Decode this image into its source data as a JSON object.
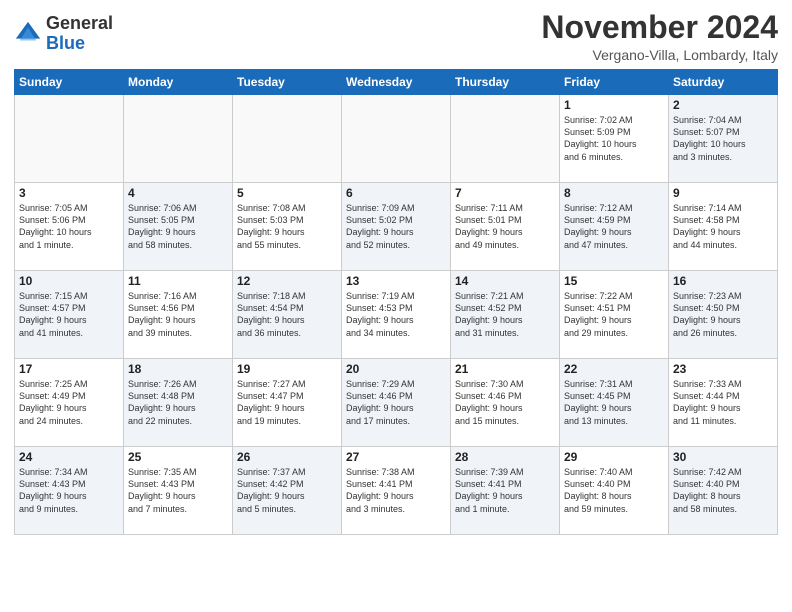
{
  "logo": {
    "line1": "General",
    "line2": "Blue"
  },
  "title": "November 2024",
  "location": "Vergano-Villa, Lombardy, Italy",
  "days_of_week": [
    "Sunday",
    "Monday",
    "Tuesday",
    "Wednesday",
    "Thursday",
    "Friday",
    "Saturday"
  ],
  "weeks": [
    [
      {
        "day": "",
        "info": "",
        "shaded": false,
        "empty": true
      },
      {
        "day": "",
        "info": "",
        "shaded": false,
        "empty": true
      },
      {
        "day": "",
        "info": "",
        "shaded": false,
        "empty": true
      },
      {
        "day": "",
        "info": "",
        "shaded": false,
        "empty": true
      },
      {
        "day": "",
        "info": "",
        "shaded": false,
        "empty": true
      },
      {
        "day": "1",
        "info": "Sunrise: 7:02 AM\nSunset: 5:09 PM\nDaylight: 10 hours\nand 6 minutes.",
        "shaded": false,
        "empty": false
      },
      {
        "day": "2",
        "info": "Sunrise: 7:04 AM\nSunset: 5:07 PM\nDaylight: 10 hours\nand 3 minutes.",
        "shaded": true,
        "empty": false
      }
    ],
    [
      {
        "day": "3",
        "info": "Sunrise: 7:05 AM\nSunset: 5:06 PM\nDaylight: 10 hours\nand 1 minute.",
        "shaded": false,
        "empty": false
      },
      {
        "day": "4",
        "info": "Sunrise: 7:06 AM\nSunset: 5:05 PM\nDaylight: 9 hours\nand 58 minutes.",
        "shaded": true,
        "empty": false
      },
      {
        "day": "5",
        "info": "Sunrise: 7:08 AM\nSunset: 5:03 PM\nDaylight: 9 hours\nand 55 minutes.",
        "shaded": false,
        "empty": false
      },
      {
        "day": "6",
        "info": "Sunrise: 7:09 AM\nSunset: 5:02 PM\nDaylight: 9 hours\nand 52 minutes.",
        "shaded": true,
        "empty": false
      },
      {
        "day": "7",
        "info": "Sunrise: 7:11 AM\nSunset: 5:01 PM\nDaylight: 9 hours\nand 49 minutes.",
        "shaded": false,
        "empty": false
      },
      {
        "day": "8",
        "info": "Sunrise: 7:12 AM\nSunset: 4:59 PM\nDaylight: 9 hours\nand 47 minutes.",
        "shaded": true,
        "empty": false
      },
      {
        "day": "9",
        "info": "Sunrise: 7:14 AM\nSunset: 4:58 PM\nDaylight: 9 hours\nand 44 minutes.",
        "shaded": false,
        "empty": false
      }
    ],
    [
      {
        "day": "10",
        "info": "Sunrise: 7:15 AM\nSunset: 4:57 PM\nDaylight: 9 hours\nand 41 minutes.",
        "shaded": true,
        "empty": false
      },
      {
        "day": "11",
        "info": "Sunrise: 7:16 AM\nSunset: 4:56 PM\nDaylight: 9 hours\nand 39 minutes.",
        "shaded": false,
        "empty": false
      },
      {
        "day": "12",
        "info": "Sunrise: 7:18 AM\nSunset: 4:54 PM\nDaylight: 9 hours\nand 36 minutes.",
        "shaded": true,
        "empty": false
      },
      {
        "day": "13",
        "info": "Sunrise: 7:19 AM\nSunset: 4:53 PM\nDaylight: 9 hours\nand 34 minutes.",
        "shaded": false,
        "empty": false
      },
      {
        "day": "14",
        "info": "Sunrise: 7:21 AM\nSunset: 4:52 PM\nDaylight: 9 hours\nand 31 minutes.",
        "shaded": true,
        "empty": false
      },
      {
        "day": "15",
        "info": "Sunrise: 7:22 AM\nSunset: 4:51 PM\nDaylight: 9 hours\nand 29 minutes.",
        "shaded": false,
        "empty": false
      },
      {
        "day": "16",
        "info": "Sunrise: 7:23 AM\nSunset: 4:50 PM\nDaylight: 9 hours\nand 26 minutes.",
        "shaded": true,
        "empty": false
      }
    ],
    [
      {
        "day": "17",
        "info": "Sunrise: 7:25 AM\nSunset: 4:49 PM\nDaylight: 9 hours\nand 24 minutes.",
        "shaded": false,
        "empty": false
      },
      {
        "day": "18",
        "info": "Sunrise: 7:26 AM\nSunset: 4:48 PM\nDaylight: 9 hours\nand 22 minutes.",
        "shaded": true,
        "empty": false
      },
      {
        "day": "19",
        "info": "Sunrise: 7:27 AM\nSunset: 4:47 PM\nDaylight: 9 hours\nand 19 minutes.",
        "shaded": false,
        "empty": false
      },
      {
        "day": "20",
        "info": "Sunrise: 7:29 AM\nSunset: 4:46 PM\nDaylight: 9 hours\nand 17 minutes.",
        "shaded": true,
        "empty": false
      },
      {
        "day": "21",
        "info": "Sunrise: 7:30 AM\nSunset: 4:46 PM\nDaylight: 9 hours\nand 15 minutes.",
        "shaded": false,
        "empty": false
      },
      {
        "day": "22",
        "info": "Sunrise: 7:31 AM\nSunset: 4:45 PM\nDaylight: 9 hours\nand 13 minutes.",
        "shaded": true,
        "empty": false
      },
      {
        "day": "23",
        "info": "Sunrise: 7:33 AM\nSunset: 4:44 PM\nDaylight: 9 hours\nand 11 minutes.",
        "shaded": false,
        "empty": false
      }
    ],
    [
      {
        "day": "24",
        "info": "Sunrise: 7:34 AM\nSunset: 4:43 PM\nDaylight: 9 hours\nand 9 minutes.",
        "shaded": true,
        "empty": false
      },
      {
        "day": "25",
        "info": "Sunrise: 7:35 AM\nSunset: 4:43 PM\nDaylight: 9 hours\nand 7 minutes.",
        "shaded": false,
        "empty": false
      },
      {
        "day": "26",
        "info": "Sunrise: 7:37 AM\nSunset: 4:42 PM\nDaylight: 9 hours\nand 5 minutes.",
        "shaded": true,
        "empty": false
      },
      {
        "day": "27",
        "info": "Sunrise: 7:38 AM\nSunset: 4:41 PM\nDaylight: 9 hours\nand 3 minutes.",
        "shaded": false,
        "empty": false
      },
      {
        "day": "28",
        "info": "Sunrise: 7:39 AM\nSunset: 4:41 PM\nDaylight: 9 hours\nand 1 minute.",
        "shaded": true,
        "empty": false
      },
      {
        "day": "29",
        "info": "Sunrise: 7:40 AM\nSunset: 4:40 PM\nDaylight: 8 hours\nand 59 minutes.",
        "shaded": false,
        "empty": false
      },
      {
        "day": "30",
        "info": "Sunrise: 7:42 AM\nSunset: 4:40 PM\nDaylight: 8 hours\nand 58 minutes.",
        "shaded": true,
        "empty": false
      }
    ]
  ]
}
